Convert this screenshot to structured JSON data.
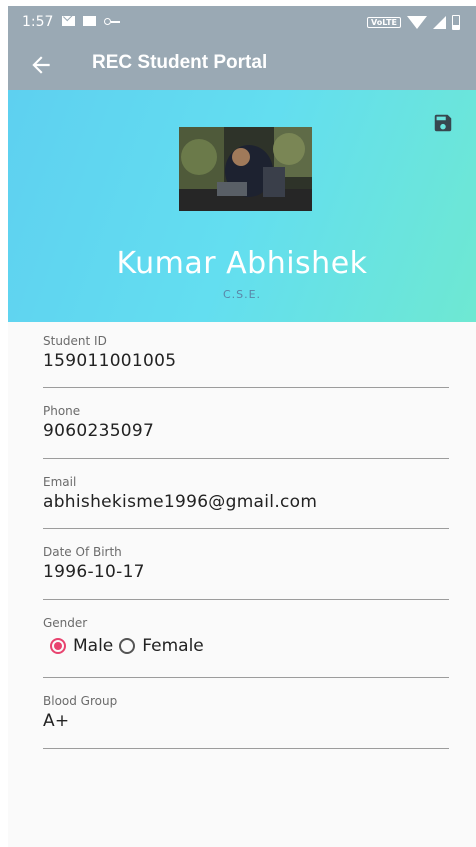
{
  "status_bar": {
    "time": "1:57",
    "volte": "VoLTE"
  },
  "app_bar": {
    "title": "REC Student Portal"
  },
  "profile": {
    "name": "Kumar Abhishek",
    "branch": "C.S.E."
  },
  "fields": [
    {
      "label": "Student ID",
      "value": "159011001005"
    },
    {
      "label": "Phone",
      "value": "9060235097"
    },
    {
      "label": "Email",
      "value": "abhishekisme1996@gmail.com"
    },
    {
      "label": "Date Of Birth",
      "value": "1996-10-17"
    }
  ],
  "gender": {
    "label": "Gender",
    "options": [
      "Male",
      "Female"
    ],
    "selected": "Male"
  },
  "blood_group": {
    "label": "Blood Group",
    "value": "A+"
  },
  "colors": {
    "app_bar": "#9aa9b4",
    "accent": "#e8436f",
    "header_start": "#5ed0f0",
    "header_end": "#6ee8d2"
  },
  "icons": {
    "back": "arrow-back-icon",
    "save": "save-icon"
  }
}
